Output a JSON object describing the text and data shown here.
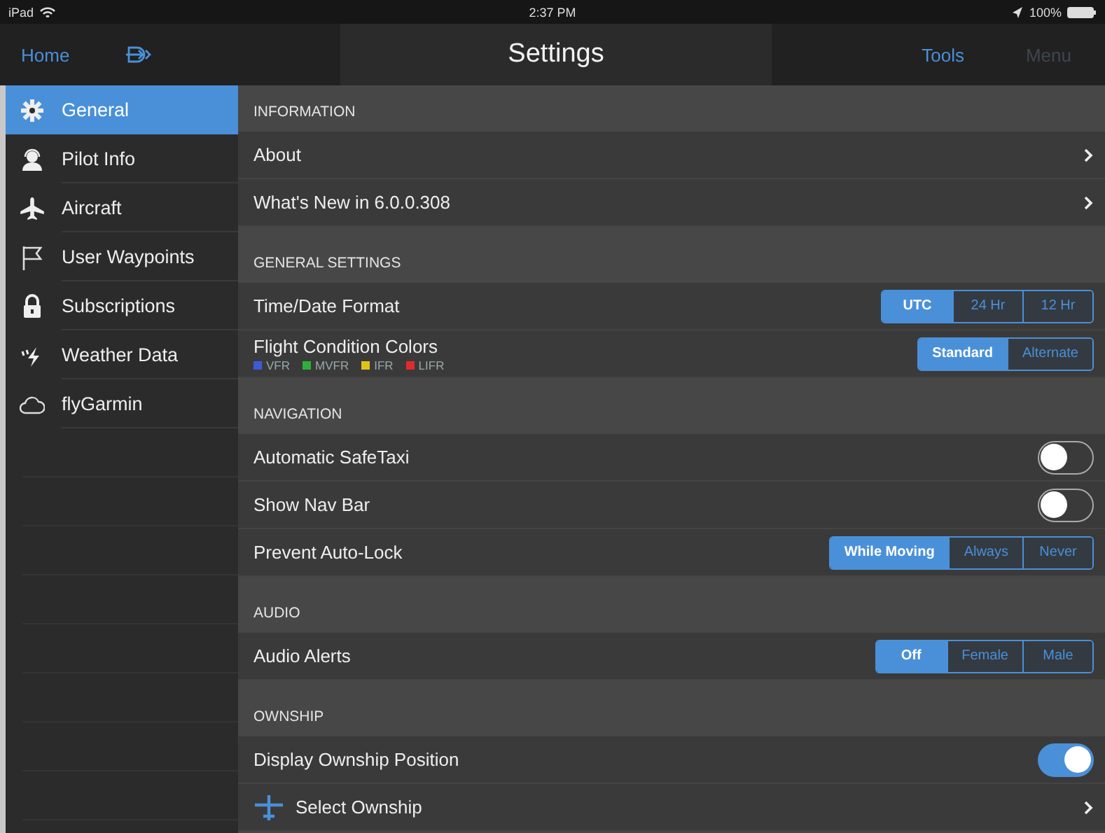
{
  "status_bar": {
    "carrier": "iPad",
    "time": "2:37 PM",
    "battery": "100%"
  },
  "nav_bar": {
    "home": "Home",
    "title": "Settings",
    "tools": "Tools",
    "menu": {
      "label": "Menu",
      "disabled": true
    }
  },
  "sidebar": {
    "items": [
      {
        "label": "General",
        "selected": true
      },
      {
        "label": "Pilot Info",
        "selected": false
      },
      {
        "label": "Aircraft",
        "selected": false
      },
      {
        "label": "User Waypoints",
        "selected": false
      },
      {
        "label": "Subscriptions",
        "selected": false
      },
      {
        "label": "Weather Data",
        "selected": false
      },
      {
        "label": "flyGarmin",
        "selected": false
      }
    ]
  },
  "sections": [
    {
      "header": "INFORMATION",
      "rows": [
        {
          "kind": "link",
          "label": "About"
        },
        {
          "kind": "link",
          "label": "What's New in 6.0.0.308"
        }
      ]
    },
    {
      "header": "GENERAL SETTINGS",
      "rows": [
        {
          "kind": "segmented",
          "label": "Time/Date Format",
          "options": [
            {
              "label": "UTC",
              "selected": true
            },
            {
              "label": "24 Hr",
              "selected": false
            },
            {
              "label": "12 Hr",
              "selected": false
            }
          ]
        },
        {
          "kind": "segmented",
          "label": "Flight Condition Colors",
          "legend": [
            {
              "label": "VFR",
              "color": "#3d5bd6"
            },
            {
              "label": "MVFR",
              "color": "#2fae3a"
            },
            {
              "label": "IFR",
              "color": "#e0c21c"
            },
            {
              "label": "LIFR",
              "color": "#e02b2b"
            }
          ],
          "options": [
            {
              "label": "Standard",
              "selected": true
            },
            {
              "label": "Alternate",
              "selected": false
            }
          ]
        }
      ]
    },
    {
      "header": "NAVIGATION",
      "rows": [
        {
          "kind": "toggle",
          "label": "Automatic SafeTaxi",
          "on": false
        },
        {
          "kind": "toggle",
          "label": "Show Nav Bar",
          "on": false
        },
        {
          "kind": "segmented",
          "label": "Prevent Auto-Lock",
          "options": [
            {
              "label": "While Moving",
              "selected": true
            },
            {
              "label": "Always",
              "selected": false
            },
            {
              "label": "Never",
              "selected": false
            }
          ]
        }
      ]
    },
    {
      "header": "AUDIO",
      "rows": [
        {
          "kind": "segmented",
          "label": "Audio Alerts",
          "options": [
            {
              "label": "Off",
              "selected": true
            },
            {
              "label": "Female",
              "selected": false
            },
            {
              "label": "Male",
              "selected": false
            }
          ]
        }
      ]
    },
    {
      "header": "OWNSHIP",
      "rows": [
        {
          "kind": "toggle",
          "label": "Display Ownship Position",
          "on": true
        },
        {
          "kind": "iconlink",
          "label": "Select Ownship"
        }
      ]
    }
  ]
}
